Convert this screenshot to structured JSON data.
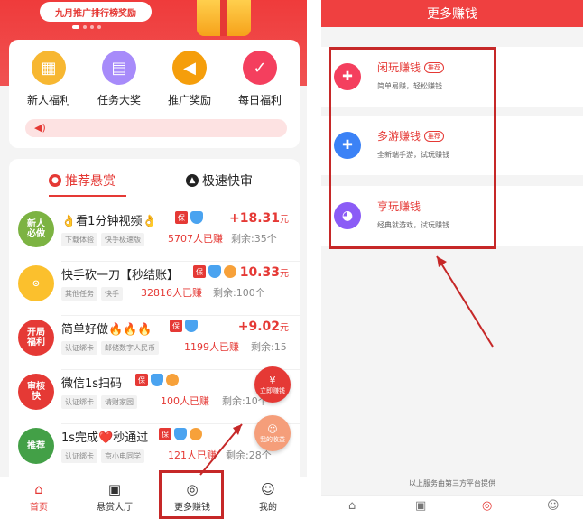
{
  "left": {
    "banner": {
      "text": "九月推广排行榜奖励"
    },
    "features": [
      {
        "label": "新人福利",
        "icon": "calendar-gift-icon",
        "color": "#f7b731"
      },
      {
        "label": "任务大奖",
        "icon": "clipboard-icon",
        "color": "#a78bfa"
      },
      {
        "label": "推广奖励",
        "icon": "megaphone-icon",
        "color": "#f59e0b"
      },
      {
        "label": "每日福利",
        "icon": "calendar-check-icon",
        "color": "#f43f5e"
      }
    ],
    "tabs": [
      {
        "label": "推荐悬赏",
        "icon": "flame-icon"
      },
      {
        "label": "极速快审",
        "icon": "rocket-icon"
      }
    ],
    "tasks": [
      {
        "avatar": "新人\n必做",
        "avatar_color": "#7cb342",
        "title": "👌看1分钟视频👌",
        "tags": [
          "下载体验",
          "快手极速版"
        ],
        "count": "5707人已赚",
        "remain": "剩余:35个",
        "price": "+18.31",
        "unit": "元"
      },
      {
        "avatar": "",
        "avatar_color": "#fbc02d",
        "title": "快手砍一刀【秒结账】",
        "tags": [
          "其他任务",
          "快手"
        ],
        "count": "32816人已赚",
        "remain": "剩余:100个",
        "price": "10.33",
        "unit": "元"
      },
      {
        "avatar": "开局\n福利",
        "avatar_color": "#e53935",
        "title": "简单好做🔥🔥🔥",
        "tags": [
          "认证绑卡",
          "邮储数字人民币"
        ],
        "count": "1199人已赚",
        "remain": "剩余:15",
        "price": "+9.02",
        "unit": "元"
      },
      {
        "avatar": "审核\n快",
        "avatar_color": "#e53935",
        "title": "微信1s扫码",
        "tags": [
          "认证绑卡",
          "请财家园"
        ],
        "count": "100人已赚",
        "remain": "剩余:10个",
        "price": "",
        "unit": ""
      },
      {
        "avatar": "推荐",
        "avatar_color": "#43a047",
        "title": "1s完成❤️秒通过",
        "tags": [
          "认证绑卡",
          "京小电同学"
        ],
        "count": "121人已赚",
        "remain": "剩余:28个",
        "price": "",
        "unit": ""
      }
    ],
    "float_buttons": [
      {
        "label": "立即赚钱",
        "icon": "yen-icon"
      },
      {
        "label": "我的收益",
        "icon": "smile-icon"
      }
    ],
    "nav": [
      {
        "label": "首页",
        "icon": "home-icon",
        "active": true
      },
      {
        "label": "悬赏大厅",
        "icon": "yen-doc-icon",
        "active": false
      },
      {
        "label": "更多赚钱",
        "icon": "gamepad-icon",
        "active": false
      },
      {
        "label": "我的",
        "icon": "user-icon",
        "active": false
      }
    ]
  },
  "right": {
    "header": "更多赚钱",
    "items": [
      {
        "name": "闲玩赚钱",
        "pill": "推荐",
        "desc": "简单易赚，轻松赚钱",
        "icon": "gamepad-icon",
        "color": "#f43f5e"
      },
      {
        "name": "多游赚钱",
        "pill": "推荐",
        "desc": "全新端手游，试玩赚钱",
        "icon": "controller-icon",
        "color": "#3b82f6"
      },
      {
        "name": "享玩赚钱",
        "pill": "",
        "desc": "经典就游戏，试玩赚钱",
        "icon": "pacman-icon",
        "color": "#8b5cf6"
      }
    ],
    "footer": "以上服务由第三方平台提供",
    "nav_icons": [
      "home-icon",
      "yen-doc-icon",
      "gamepad-icon",
      "user-icon"
    ]
  },
  "colors": {
    "accent": "#e53935",
    "highlight_box": "#c62828"
  }
}
